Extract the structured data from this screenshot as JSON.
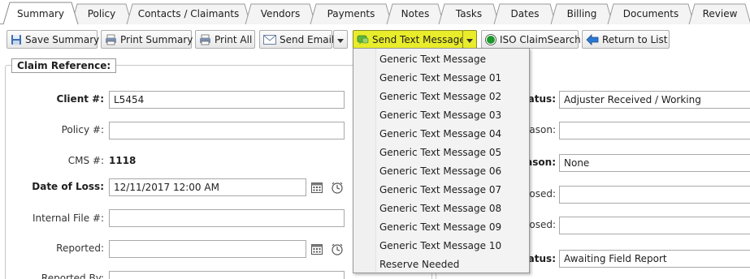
{
  "tabs": [
    {
      "label": "Summary",
      "active": true
    },
    {
      "label": "Policy"
    },
    {
      "label": "Contacts / Claimants"
    },
    {
      "label": "Vendors"
    },
    {
      "label": "Payments"
    },
    {
      "label": "Notes"
    },
    {
      "label": "Tasks"
    },
    {
      "label": "Dates"
    },
    {
      "label": "Billing"
    },
    {
      "label": "Documents"
    },
    {
      "label": "Review"
    }
  ],
  "toolbar": {
    "save_summary": "Save Summary",
    "print_summary": "Print Summary",
    "print_all": "Print All",
    "send_email": "Send Email",
    "send_text": "Send Text Message",
    "iso_claimsearch": "ISO ClaimSearch",
    "return_to_list": "Return to List"
  },
  "text_menu": {
    "items": [
      "Generic Text Message",
      "Generic Text Message 01",
      "Generic Text Message 02",
      "Generic Text Message 03",
      "Generic Text Message 04",
      "Generic Text Message 05",
      "Generic Text Message 06",
      "Generic Text Message 07",
      "Generic Text Message 08",
      "Generic Text Message 09",
      "Generic Text Message 10",
      "Reserve Needed"
    ]
  },
  "claim_reference": {
    "legend": "Claim Reference:",
    "client_label": "Client #:",
    "client_value": "L5454",
    "policy_label": "Policy #:",
    "policy_value": "",
    "cms_label": "CMS #:",
    "cms_value": "1118",
    "date_of_loss_label": "Date of Loss:",
    "date_of_loss_value": "12/11/2017 12:00 AM",
    "internal_file_label": "Internal File #:",
    "internal_file_value": "",
    "reported_label": "Reported:",
    "reported_value": "",
    "reported_by_label": "Reported By:"
  },
  "right_panel": {
    "status_label": "tatus:",
    "status_value": "Adjuster Received / Working",
    "reason1_label": "eason:",
    "reason1_value": "",
    "reason2_label": "eason:",
    "reason2_value": "None",
    "closed1_label": "losed:",
    "closed1_value": "",
    "closed2_label": "losed:",
    "closed2_value": "",
    "status2_label": "tatus:",
    "status2_value": "Awaiting Field Report"
  },
  "colors": {
    "highlight": "#e8ec2a",
    "iso_green": "#1a9a2a",
    "arrow_blue": "#2a78d0"
  }
}
